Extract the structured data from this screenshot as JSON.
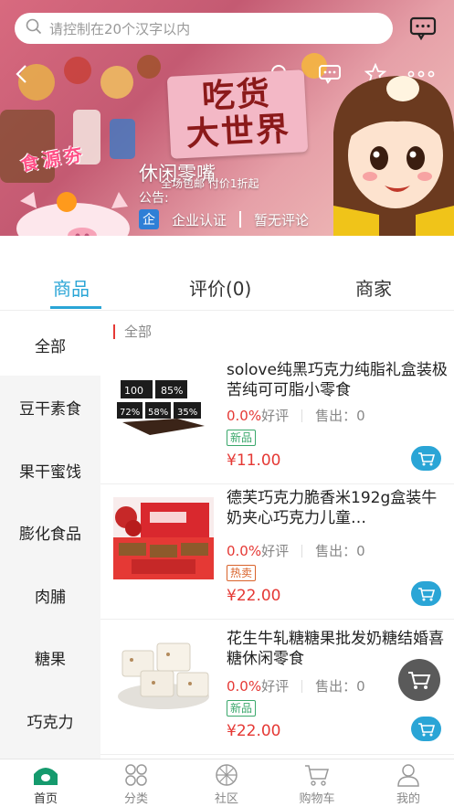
{
  "search": {
    "placeholder": "请控制在20个汉字以内"
  },
  "banner": {
    "title_line1": "吃货",
    "title_line2": "大世界",
    "logo_text": "食源夯",
    "shop_name": "休闲零嘴",
    "promo": "全场包邮 付价1折起",
    "notice_label": "公告:",
    "enterprise_badge": "企",
    "cert_label": "企业认证",
    "review_label": "暂无评论"
  },
  "tabs": [
    {
      "label": "商品",
      "active": true
    },
    {
      "label": "评价(0)",
      "active": false
    },
    {
      "label": "商家",
      "active": false
    }
  ],
  "categories": [
    {
      "label": "全部",
      "active": true
    },
    {
      "label": "豆干素食",
      "active": false
    },
    {
      "label": "果干蜜饯",
      "active": false
    },
    {
      "label": "膨化食品",
      "active": false
    },
    {
      "label": "肉脯",
      "active": false
    },
    {
      "label": "糖果",
      "active": false
    },
    {
      "label": "巧克力",
      "active": false
    }
  ],
  "section_title": "全部",
  "products": [
    {
      "name": "solove纯黑巧克力纯脂礼盒装极苦纯可可脂小零食",
      "rate": "0.0%",
      "rate_label": "好评",
      "sales": "售出：0",
      "tag": "新品",
      "tag_type": "new",
      "price": "¥11.00",
      "thumb_labels": [
        "100",
        "85%",
        "72%",
        "58%",
        "35%"
      ]
    },
    {
      "name": "德芙巧克力脆香米192g盒装牛奶夹心巧克力儿童…",
      "rate": "0.0%",
      "rate_label": "好评",
      "sales": "售出：0",
      "tag": "热卖",
      "tag_type": "hot",
      "price": "¥22.00",
      "thumb_labels": []
    },
    {
      "name": "花生牛轧糖糖果批发奶糖结婚喜糖休闲零食",
      "rate": "0.0%",
      "rate_label": "好评",
      "sales": "售出：0",
      "tag": "新品",
      "tag_type": "new",
      "price": "¥22.00",
      "thumb_labels": []
    }
  ],
  "bottom_nav": [
    {
      "label": "首页",
      "icon": "home-icon",
      "active": true
    },
    {
      "label": "分类",
      "icon": "category-icon",
      "active": false
    },
    {
      "label": "社区",
      "icon": "community-icon",
      "active": false
    },
    {
      "label": "购物车",
      "icon": "cart-icon",
      "active": false
    },
    {
      "label": "我的",
      "icon": "user-icon",
      "active": false
    }
  ],
  "colors": {
    "accent": "#2aa5d6",
    "price": "#e53935",
    "banner": "#d86a7f"
  }
}
